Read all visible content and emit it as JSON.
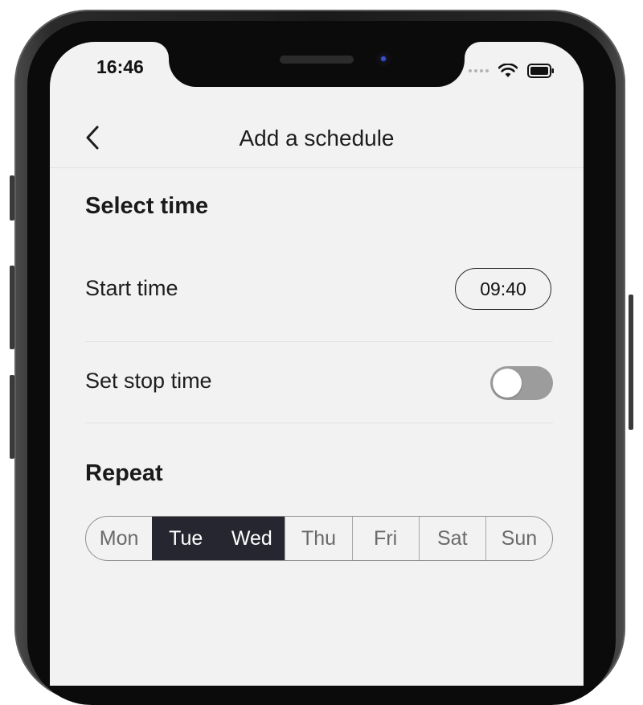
{
  "status_bar": {
    "time": "16:46",
    "icons": [
      "signal-dots-icon",
      "wifi-icon",
      "battery-icon"
    ]
  },
  "nav": {
    "back_icon": "chevron-left-icon",
    "title": "Add a schedule"
  },
  "select_time": {
    "heading": "Select time",
    "start_time_label": "Start time",
    "start_time_value": "09:40",
    "stop_time_label": "Set stop time",
    "stop_time_enabled": false
  },
  "repeat": {
    "heading": "Repeat",
    "days": [
      {
        "label": "Mon",
        "selected": false
      },
      {
        "label": "Tue",
        "selected": true
      },
      {
        "label": "Wed",
        "selected": true
      },
      {
        "label": "Thu",
        "selected": false
      },
      {
        "label": "Fri",
        "selected": false
      },
      {
        "label": "Sat",
        "selected": false
      },
      {
        "label": "Sun",
        "selected": false
      }
    ]
  },
  "colors": {
    "background": "#f2f2f2",
    "selected_day": "#262630",
    "toggle_off": "#9c9c9c",
    "text": "#1a1a1a"
  }
}
